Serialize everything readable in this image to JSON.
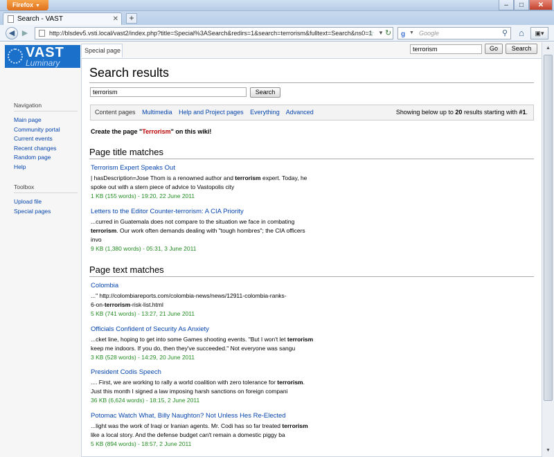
{
  "window": {
    "app_button": "Firefox",
    "tab_title": "Search - VAST",
    "url": "http://blsdev5.vsti.local/vast2/index.php?title=Special%3ASearch&redirs=1&search=terrorism&fulltext=Search&ns0=1",
    "search_engine_placeholder": "Google"
  },
  "wiki": {
    "logo_line1": "VAST",
    "logo_line2": "Luminary",
    "namespace_tab": "Special page",
    "header_search_value": "terrorism",
    "go_button": "Go",
    "search_button": "Search",
    "navigation_title": "Navigation",
    "navigation": [
      "Main page",
      "Community portal",
      "Current events",
      "Recent changes",
      "Random page",
      "Help"
    ],
    "toolbox_title": "Toolbox",
    "toolbox": [
      "Upload file",
      "Special pages"
    ]
  },
  "main": {
    "heading": "Search results",
    "search_value": "terrorism",
    "search_button": "Search",
    "filters": {
      "current": "Content pages",
      "links": [
        "Multimedia",
        "Help and Project pages",
        "Everything",
        "Advanced"
      ]
    },
    "info": {
      "prefix": "Showing below up to ",
      "count": "20",
      "middle": " results starting with ",
      "start": "#1",
      "suffix": "."
    },
    "create": {
      "prefix": "Create the page \"",
      "link": "Terrorism",
      "suffix": "\" on this wiki!"
    },
    "title_matches_heading": "Page title matches",
    "text_matches_heading": "Page text matches"
  },
  "title_matches": [
    {
      "title": "Terrorism Expert Speaks Out",
      "lines": [
        [
          "| hasDescription=Jose Thom is a renowned author and ",
          "terrorism",
          " expert. Today, he"
        ],
        [
          "spoke out with a stern piece of advice to Vastopolis city",
          "",
          ""
        ]
      ],
      "meta": "1 KB (155 words) - 19:20, 22 June 2011"
    },
    {
      "title": "Letters to the Editor Counter-terrorism: A CIA Priority",
      "lines": [
        [
          "...curred in Guatemala does not compare to the situation we face in combating",
          "",
          ""
        ],
        [
          "",
          "terrorism",
          ". Our work often demands dealing with \"tough hombres\"; the CIA officers"
        ],
        [
          "invo",
          "",
          ""
        ]
      ],
      "meta": "9 KB (1,380 words) - 05:31, 3 June 2011"
    }
  ],
  "text_matches": [
    {
      "title": "Colombia",
      "lines": [
        [
          "...\" http://colombiareports.com/colombia-news/news/12911-colombia-ranks-",
          "",
          ""
        ],
        [
          "6-on-",
          "terrorism",
          "-risk-list.html"
        ]
      ],
      "meta": "5 KB (741 words) - 13:27, 21 June 2011"
    },
    {
      "title": "Officials Confident of Security As Anxiety",
      "lines": [
        [
          "...cket line, hoping to get into some Games shooting events. \"But I won't let ",
          "terrorism",
          ""
        ],
        [
          "keep me indoors. If you do, then they've succeeded.\" Not everyone was sangu",
          "",
          ""
        ]
      ],
      "meta": "3 KB (528 words) - 14:29, 20 June 2011"
    },
    {
      "title": "President Codis Speech",
      "lines": [
        [
          ".... First, we are working to rally a world coalition with zero tolerance for ",
          "terrorism",
          "."
        ],
        [
          "Just this month I signed a law imposing harsh sanctions on foreign compani",
          "",
          ""
        ]
      ],
      "meta": "36 KB (6,624 words) - 18:15, 2 June 2011"
    },
    {
      "title": "Potomac Watch What, Billy Naughton? Not Unless Hes Re-Elected",
      "lines": [
        [
          "...light was the work of Iraqi or Iranian agents. Mr. Codi has so far treated ",
          "terrorism",
          ""
        ],
        [
          "like a local story. And the defense budget can't remain a domestic piggy ba",
          "",
          ""
        ]
      ],
      "meta": "5 KB (894 words) - 18:57, 2 June 2011"
    }
  ]
}
